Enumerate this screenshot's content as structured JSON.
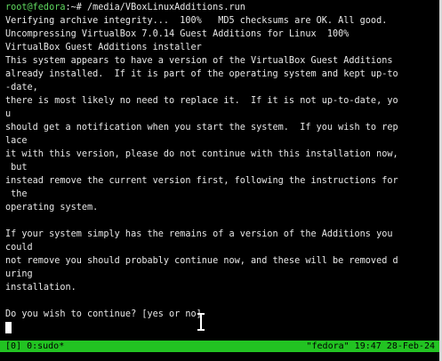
{
  "terminal": {
    "prompt": {
      "user_host": "root@fedora",
      "path_cmd": ":~# /media/VBoxLinuxAdditions.run"
    },
    "lines": [
      "Verifying archive integrity...  100%   MD5 checksums are OK. All good.",
      "Uncompressing VirtualBox 7.0.14 Guest Additions for Linux  100%",
      "VirtualBox Guest Additions installer",
      "This system appears to have a version of the VirtualBox Guest Additions",
      "already installed.  If it is part of the operating system and kept up-to",
      "-date,",
      "there is most likely no need to replace it.  If it is not up-to-date, yo",
      "u",
      "should get a notification when you start the system.  If you wish to rep",
      "lace",
      "it with this version, please do not continue with this installation now,",
      " but",
      "instead remove the current version first, following the instructions for",
      " the",
      "operating system.",
      "",
      "If your system simply has the remains of a version of the Additions you",
      "could",
      "not remove you should probably continue now, and these will be removed d",
      "uring",
      "installation.",
      "",
      "Do you wish to continue? [yes or no]"
    ]
  },
  "statusbar": {
    "left": "[0] 0:sudo*",
    "right": "\"fedora\" 19:47 28-Feb-24"
  },
  "colors": {
    "background": "#000000",
    "text": "#e8e8e8",
    "prompt_user": "#5fd75f",
    "statusbar_bg": "#22c322"
  }
}
